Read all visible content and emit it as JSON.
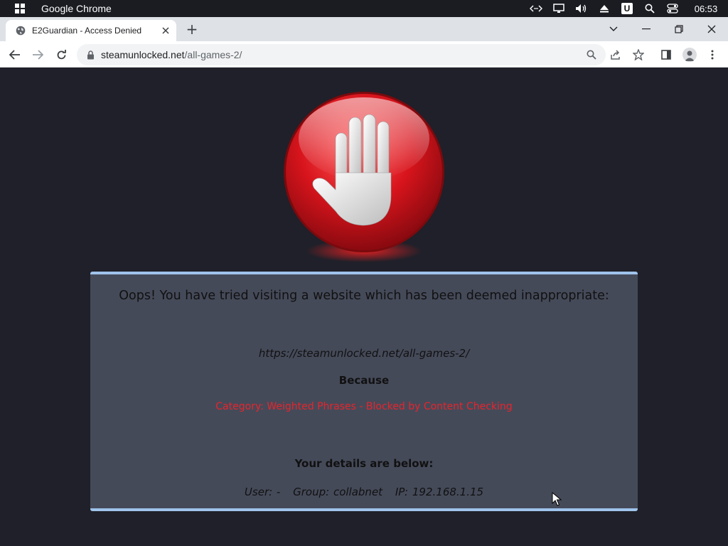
{
  "os": {
    "app_name": "Google Chrome",
    "clock": "06:53",
    "tray_letter": "U"
  },
  "browser": {
    "tab_title": "E2Guardian - Access Denied",
    "new_tab_symbol": "+",
    "url_host": "steamunlocked.net",
    "url_path": "/all-games-2/"
  },
  "blockpage": {
    "heading": "Oops! You have tried visiting a website which has been deemed inappropriate:",
    "blocked_url": "https://steamunlocked.net/all-games-2/",
    "because_label": "Because",
    "reason": "Category: Weighted Phrases - Blocked by Content Checking",
    "details_label": "Your details are below:",
    "user": "User: -",
    "group": "Group: collabnet",
    "ip": "IP: 192.168.1.15"
  },
  "colors": {
    "page_bg": "#1f2029",
    "panel_bg": "#454a59",
    "panel_border": "#9fc4ec",
    "reason_text": "#e8242c",
    "stop_red": "#d8141c"
  }
}
